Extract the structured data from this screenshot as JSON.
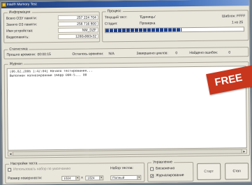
{
  "window": {
    "title": "Intel® Memory Test"
  },
  "info_panel": {
    "legend": "Информация",
    "rows": [
      {
        "label": "Всего ОЗУ памяти:",
        "value": "257 224 704"
      },
      {
        "label": "Занято ОЗ памяти:",
        "value": "256 716 800"
      },
      {
        "label": "Имя устройства:",
        "value": "NM_DZF"
      },
      {
        "label": "Видеопамять:",
        "value": "1280x960x32"
      }
    ]
  },
  "process_panel": {
    "legend": "Процесс",
    "current_test_label": "Текущий тест:",
    "current_test_value": "'Единицы'",
    "pattern_label": "Шаблон: FFFF",
    "stage_label": "Стадия:",
    "stage_value": "Проверка",
    "count_label": "1 из 25",
    "progress_fraction": 0.55
  },
  "stats_panel": {
    "legend": "Статистика",
    "elapsed_label": "Прошло времени:",
    "elapsed_value": "00:00:15",
    "remaining_label": "Осталось времени:",
    "remaining_value": "N/A",
    "passes_label": "Завершено циклов:",
    "passes_value": "0",
    "errors_label": "Найдено ошибок:",
    "errors_value": "0"
  },
  "journal_panel": {
    "legend": "Журнал",
    "lines": [
      "[06.02.2006 1:42:04] Начало тестирования...",
      "Выполнен полноэкранный 16bpp DDR-5... 00"
    ]
  },
  "settings_panel": {
    "legend": "Настройки теста",
    "auto_label": "Использовать набор по умолчанию",
    "test_set_label": "Набор тестов:",
    "surface_label": "Размер поверхности:",
    "width_value": "1024",
    "height_value": "1024",
    "mode_value": "Полный"
  },
  "control_panel": {
    "legend": "Управление",
    "infinite_label": "Бесконечно",
    "infinite_checked": false,
    "journal_label": "Журналирование",
    "journal_checked": true
  },
  "buttons": {
    "start": "Старт",
    "stop": "Стоп"
  },
  "banner": {
    "text": "FREE"
  }
}
